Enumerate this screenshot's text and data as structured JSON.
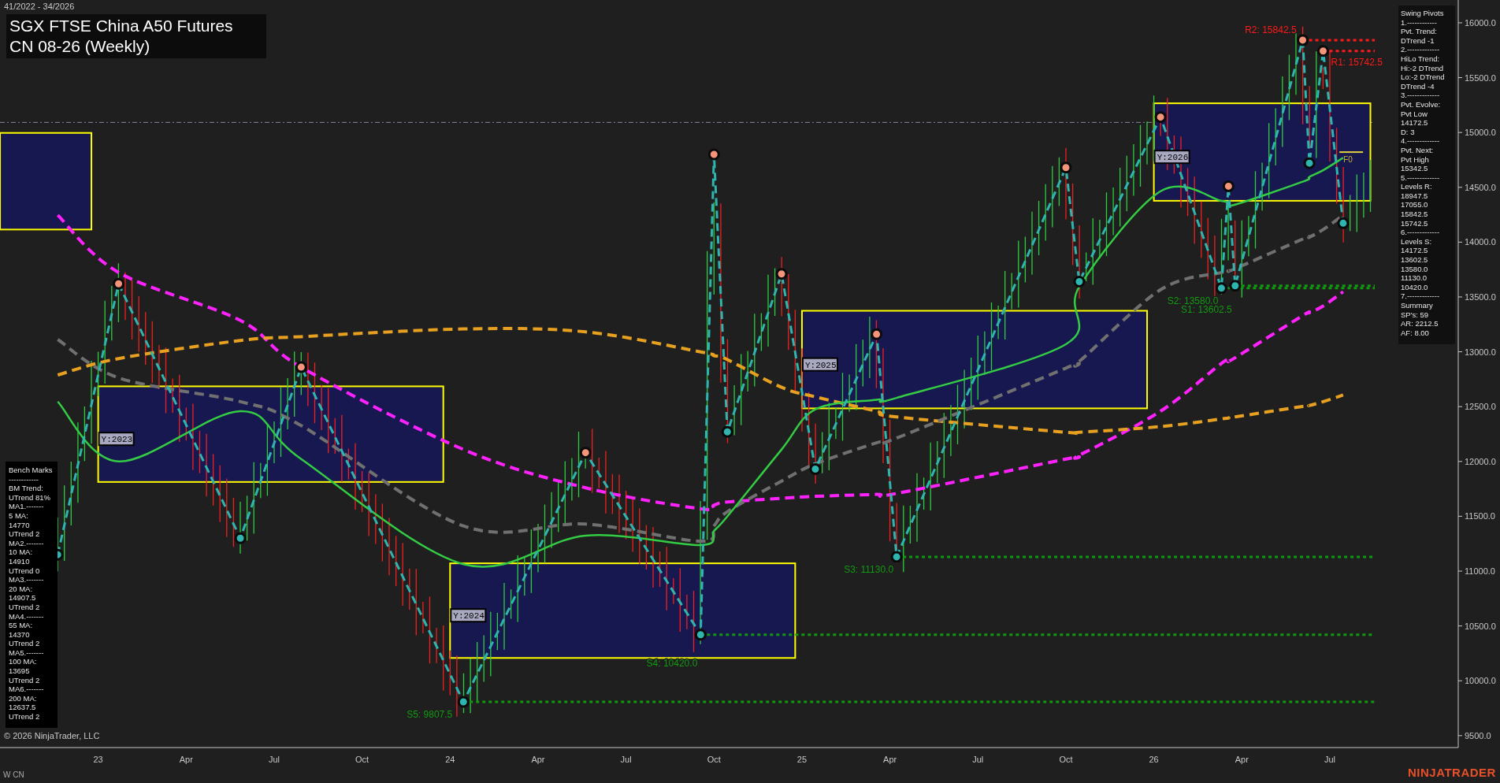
{
  "header": {
    "date_range": "41/2022 - 34/2026",
    "title_lines": [
      "SGX FTSE China A50 Futures",
      "CN 08-26 (Weekly)"
    ]
  },
  "chart": {
    "chart_data": {
      "type": "line",
      "xlim": [
        22.721,
        26.865
      ],
      "ylim": [
        9391,
        16208
      ],
      "x": [
        22.885,
        23.058,
        23.404,
        23.577,
        24.038,
        24.385,
        24.712,
        24.75,
        24.788,
        24.942,
        25.038,
        25.212,
        25.269,
        25.75,
        25.788,
        26.019,
        26.192,
        26.212,
        26.231,
        26.423,
        26.442,
        26.481,
        26.538
      ],
      "xticks": [
        {
          "value": 23,
          "label": "23"
        },
        {
          "value": 23.25,
          "label": "Apr"
        },
        {
          "value": 23.5,
          "label": "Jul"
        },
        {
          "value": 23.75,
          "label": "Oct"
        },
        {
          "value": 24,
          "label": "24"
        },
        {
          "value": 24.25,
          "label": "Apr"
        },
        {
          "value": 24.5,
          "label": "Jul"
        },
        {
          "value": 24.75,
          "label": "Oct"
        },
        {
          "value": 25,
          "label": "25"
        },
        {
          "value": 25.25,
          "label": "Apr"
        },
        {
          "value": 25.5,
          "label": "Jul"
        },
        {
          "value": 25.75,
          "label": "Oct"
        },
        {
          "value": 26,
          "label": "26"
        },
        {
          "value": 26.25,
          "label": "Apr"
        },
        {
          "value": 26.5,
          "label": "Jul"
        }
      ],
      "yticks": [
        {
          "value": 9500,
          "label": "9500.0"
        },
        {
          "value": 10000,
          "label": "10000.0"
        },
        {
          "value": 10500,
          "label": "10500.0"
        },
        {
          "value": 11000,
          "label": "11000.0"
        },
        {
          "value": 11500,
          "label": "11500.0"
        },
        {
          "value": 12000,
          "label": "12000.0"
        },
        {
          "value": 12500,
          "label": "12500.0"
        },
        {
          "value": 13000,
          "label": "13000.0"
        },
        {
          "value": 13500,
          "label": "13500.0"
        },
        {
          "value": 14000,
          "label": "14000.0"
        },
        {
          "value": 14500,
          "label": "14500.0"
        },
        {
          "value": 15000,
          "label": "15000.0"
        },
        {
          "value": 15500,
          "label": "15500.0"
        },
        {
          "value": 16000,
          "label": "16000.0"
        }
      ],
      "series": [
        {
          "color": "#ff22ff",
          "line_style": "dashed",
          "values": [
            14246,
            13723,
            13286,
            12859,
            12109,
            11760,
            11568,
            11603,
            11630,
            11664,
            11682,
            11700,
            11708,
            12022,
            12057,
            12458,
            12894,
            12920,
            12946,
            13330,
            13356,
            13417,
            13548
          ]
        },
        {
          "color": "#e8a020",
          "line_style": "dashed",
          "values": [
            12789,
            12938,
            13103,
            13138,
            13208,
            13182,
            12999,
            12964,
            12929,
            12676,
            12589,
            12458,
            12406,
            12266,
            12266,
            12318,
            12388,
            12397,
            12406,
            12502,
            12510,
            12545,
            12606
          ]
        },
        {
          "color": "#707070",
          "line_style": "dashed",
          "values": [
            13112,
            12763,
            12545,
            12327,
            11412,
            11429,
            11272,
            11412,
            11542,
            11821,
            11978,
            12170,
            12213,
            12851,
            12912,
            13566,
            13723,
            13740,
            13758,
            14028,
            14045,
            14115,
            14246
          ]
        },
        {
          "color": "#33cc44",
          "line_style": "solid",
          "values": [
            12545,
            12000,
            12458,
            12022,
            11063,
            11324,
            11237,
            11368,
            11499,
            12109,
            12475,
            12563,
            12580,
            13069,
            13592,
            14464,
            14377,
            14359,
            14342,
            14551,
            14595,
            14656,
            14769
          ]
        },
        {
          "color": "#2fb5b0",
          "line_style": "dashed",
          "marker": "circle",
          "values": [
            11150,
            13620,
            11300,
            12860,
            9807.5,
            12080,
            10420,
            14800,
            12270,
            13710,
            11930,
            13160,
            11130,
            14680,
            13640,
            15140,
            13580,
            14510,
            13602.5,
            15842.5,
            14720,
            15742.5,
            14172.5
          ]
        }
      ],
      "annotations": [
        {
          "text": "R2: 15842.5",
          "x": 26.423,
          "y": 15842.5
        },
        {
          "text": "R1: 15742.5",
          "x": 26.481,
          "y": 15742.5
        },
        {
          "text": "S2: 13580.0",
          "x": 26.192,
          "y": 13580
        },
        {
          "text": "S1: 13602.5",
          "x": 26.231,
          "y": 13602.5
        },
        {
          "text": "S3: 11130.0",
          "x": 25.269,
          "y": 11130
        },
        {
          "text": "S4: 10420.0",
          "x": 24.712,
          "y": 10420
        },
        {
          "text": "S5: 9807.5",
          "x": 24.038,
          "y": 9807.5
        }
      ]
    },
    "year_labels": [
      "Y:2023",
      "Y:2024",
      "Y:2025",
      "Y:2026"
    ],
    "marker": {
      "label": "F0"
    }
  },
  "swing_pivots_panel": {
    "lines": [
      "Swing Pivots",
      "1.------------",
      "Pvt. Trend:",
      "DTrend -1",
      "2.-------------",
      "HiLo Trend:",
      "Hi:-2 DTrend",
      "Lo:-2 DTrend",
      "DTrend -4",
      "3.-------------",
      "Pvt. Evolve:",
      "Pvt Low",
      "14172.5",
      "D: 3",
      "4.-------------",
      "Pvt. Next:",
      "Pvt High",
      "15342.5",
      "5.-------------",
      "Levels R:",
      "18947.5",
      "17055.0",
      "15842.5",
      "15742.5",
      "6.-------------",
      "Levels S:",
      "14172.5",
      "13602.5",
      "13580.0",
      "11130.0",
      "10420.0",
      "7.-------------",
      "Summary",
      "SP's: 59",
      "AR: 2212.5",
      "AF: 8.00"
    ]
  },
  "bench_marks_panel": {
    "lines": [
      "Bench Marks",
      "------------",
      "BM Trend:",
      "UTrend 81%",
      "MA1.-------",
      "5 MA:",
      "14770",
      "UTrend 2",
      "MA2.-------",
      "10 MA:",
      "14910",
      "UTrend 0",
      "MA3.-------",
      "20 MA:",
      "14907.5",
      "UTrend 2",
      "MA4.-------",
      "55 MA:",
      "14370",
      "UTrend 2",
      "MA5.-------",
      "100 MA:",
      "13695",
      "UTrend 2",
      "MA6.-------",
      "200 MA:",
      "12637.5",
      "UTrend 2"
    ]
  },
  "footer": {
    "copyright": "© 2026 NinjaTrader, LLC",
    "instrument": "W CN",
    "logo": "NINJATRADER"
  }
}
